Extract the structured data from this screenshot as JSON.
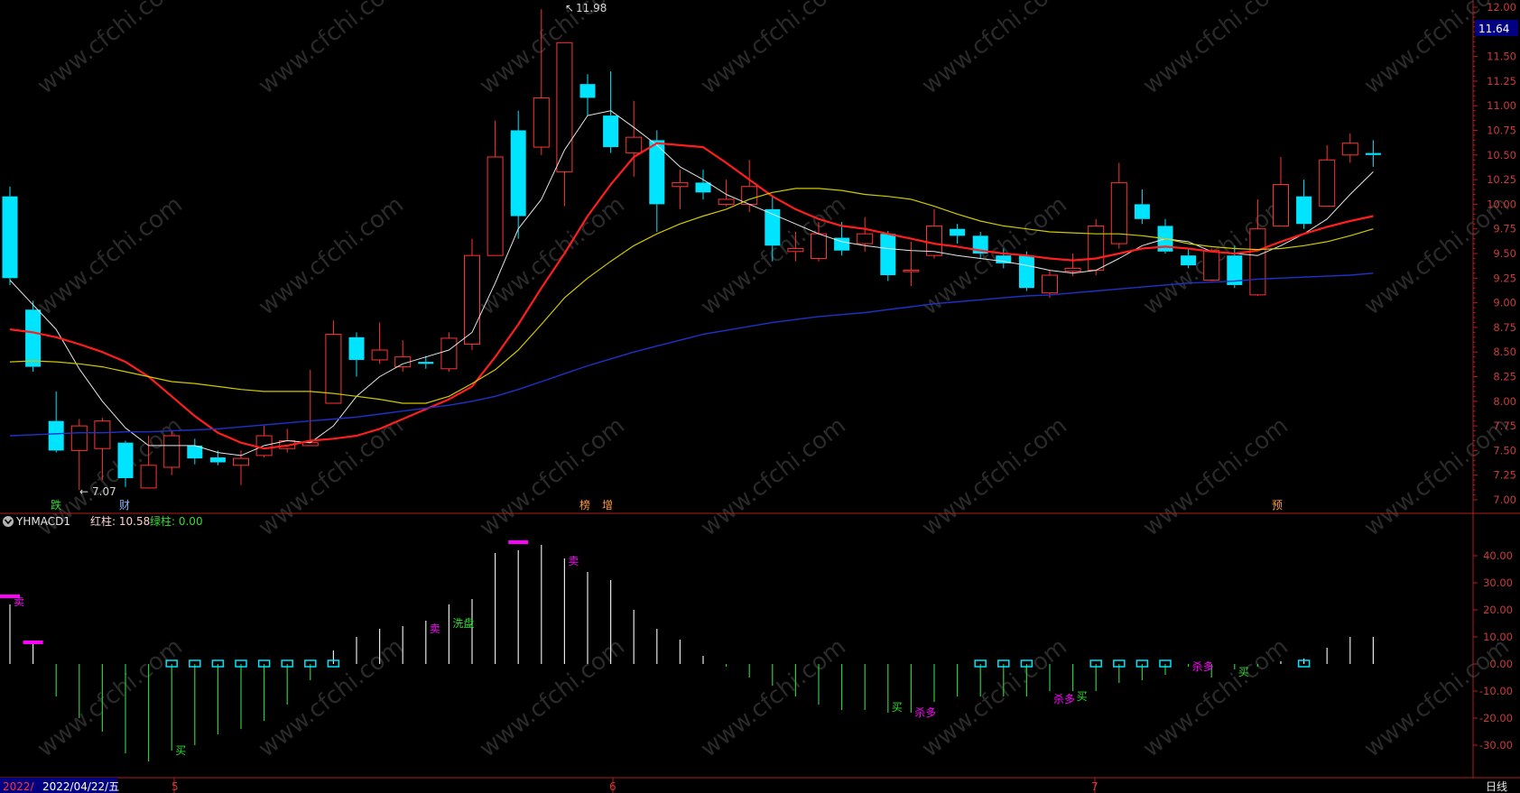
{
  "colors": {
    "bg": "#000000",
    "up": "#ff3232",
    "down": "#00e4ff",
    "axis": "#b41e1e",
    "axis_text": "#c83c3c",
    "ma5": "#e6e6e6",
    "ma10": "#ff1e1e",
    "ma20": "#d2c800",
    "ma60": "#1e32c8",
    "macd_pos": "#e6e6e6",
    "macd_neg": "#2fc83c",
    "marker_cyan": "#00e4ff",
    "magenta": "#ff00ff",
    "green_text": "#32dc32"
  },
  "price_axis": {
    "min": 7.0,
    "max": 12.0,
    "ticks": [
      "7.00",
      "7.25",
      "7.50",
      "7.75",
      "8.00",
      "8.25",
      "8.50",
      "8.75",
      "9.00",
      "9.25",
      "9.50",
      "9.75",
      "10.00",
      "10.25",
      "10.50",
      "10.75",
      "11.00",
      "11.25",
      "11.50",
      "11.75",
      "12.00"
    ],
    "current_price": "11.64"
  },
  "macd_axis": {
    "min": -42,
    "max": 52,
    "ticks": [
      "-30.00",
      "-20.00",
      "-10.00",
      "0.00",
      "10.00",
      "20.00",
      "30.00",
      "40.00"
    ]
  },
  "annotations": {
    "high_label": "11.98",
    "low_label": "7.07"
  },
  "event_markers": [
    "跌",
    "财",
    "榜",
    "增",
    "预"
  ],
  "indicator": {
    "name": "YHMACD1",
    "red_label": "红柱: 10.58",
    "green_label": "绿柱: 0.00"
  },
  "signals": [
    "卖",
    "卖",
    "卖",
    "洗盘",
    "买",
    "买",
    "杀多",
    "杀多",
    "买",
    "杀多",
    "买"
  ],
  "time_axis": {
    "labels": [
      "2022/",
      "2022/04/22/五",
      "5",
      "6",
      "7"
    ],
    "period": "日线"
  },
  "chart_data": [
    {
      "type": "candlestick",
      "title": "",
      "xlabel": "",
      "ylabel": "",
      "ylim": [
        7.0,
        12.0
      ],
      "candles": [
        [
          10.08,
          9.25,
          10.18,
          9.18
        ],
        [
          8.93,
          8.35,
          9.02,
          8.3
        ],
        [
          7.8,
          7.5,
          8.1,
          7.48
        ],
        [
          7.5,
          7.75,
          7.82,
          7.1
        ],
        [
          7.52,
          7.8,
          7.83,
          7.2
        ],
        [
          7.58,
          7.22,
          7.6,
          7.13
        ],
        [
          7.12,
          7.35,
          7.65,
          7.12
        ],
        [
          7.33,
          7.65,
          7.7,
          7.25
        ],
        [
          7.55,
          7.42,
          7.62,
          7.36
        ],
        [
          7.43,
          7.38,
          7.5,
          7.35
        ],
        [
          7.35,
          7.42,
          7.5,
          7.15
        ],
        [
          7.45,
          7.65,
          7.75,
          7.43
        ],
        [
          7.52,
          7.6,
          7.72,
          7.48
        ],
        [
          7.55,
          7.58,
          8.32,
          7.55
        ],
        [
          7.98,
          8.68,
          8.82,
          7.98
        ],
        [
          8.65,
          8.42,
          8.7,
          8.25
        ],
        [
          8.42,
          8.52,
          8.8,
          8.38
        ],
        [
          8.35,
          8.45,
          8.62,
          8.3
        ],
        [
          8.4,
          8.38,
          8.46,
          8.33
        ],
        [
          8.33,
          8.64,
          8.7,
          8.3
        ],
        [
          8.58,
          9.48,
          9.65,
          8.52
        ],
        [
          9.48,
          10.48,
          10.85,
          9.48
        ],
        [
          10.75,
          9.88,
          10.95,
          9.65
        ],
        [
          10.58,
          11.08,
          11.98,
          10.5
        ],
        [
          10.33,
          11.64,
          11.64,
          9.98
        ],
        [
          11.22,
          11.08,
          11.32,
          10.9
        ],
        [
          10.9,
          10.58,
          11.35,
          10.52
        ],
        [
          10.52,
          10.68,
          11.05,
          10.28
        ],
        [
          10.65,
          10.0,
          10.75,
          9.72
        ],
        [
          10.18,
          10.22,
          10.35,
          9.95
        ],
        [
          10.22,
          10.12,
          10.35,
          10.05
        ],
        [
          10.0,
          10.05,
          10.25,
          9.98
        ],
        [
          10.0,
          10.18,
          10.45,
          9.92
        ],
        [
          9.95,
          9.58,
          10.08,
          9.42
        ],
        [
          9.52,
          9.55,
          9.72,
          9.42
        ],
        [
          9.45,
          9.7,
          9.82,
          9.42
        ],
        [
          9.66,
          9.53,
          9.82,
          9.48
        ],
        [
          9.6,
          9.7,
          9.87,
          9.52
        ],
        [
          9.7,
          9.28,
          9.73,
          9.22
        ],
        [
          9.32,
          9.33,
          9.62,
          9.17
        ],
        [
          9.48,
          9.78,
          9.95,
          9.45
        ],
        [
          9.75,
          9.68,
          9.8,
          9.6
        ],
        [
          9.68,
          9.5,
          9.72,
          9.45
        ],
        [
          9.48,
          9.4,
          9.55,
          9.35
        ],
        [
          9.48,
          9.15,
          9.52,
          9.12
        ],
        [
          9.1,
          9.28,
          9.33,
          9.05
        ],
        [
          9.32,
          9.35,
          9.5,
          9.27
        ],
        [
          9.33,
          9.78,
          9.85,
          9.28
        ],
        [
          9.6,
          10.22,
          10.42,
          9.55
        ],
        [
          10.0,
          9.85,
          10.15,
          9.8
        ],
        [
          9.78,
          9.52,
          9.85,
          9.5
        ],
        [
          9.48,
          9.38,
          9.55,
          9.35
        ],
        [
          9.23,
          9.53,
          9.55,
          9.22
        ],
        [
          9.48,
          9.18,
          9.58,
          9.15
        ],
        [
          9.08,
          9.75,
          10.05,
          9.07
        ],
        [
          9.78,
          10.2,
          10.48,
          9.78
        ],
        [
          10.08,
          9.8,
          10.25,
          9.75
        ],
        [
          9.98,
          10.45,
          10.6,
          9.98
        ],
        [
          10.5,
          10.62,
          10.72,
          10.42
        ],
        [
          10.52,
          10.5,
          10.65,
          10.38
        ]
      ],
      "series": [
        {
          "name": "MA5",
          "values": [
            9.23,
            8.98,
            8.73,
            8.33,
            8.0,
            7.73,
            7.55,
            7.55,
            7.55,
            7.48,
            7.45,
            7.55,
            7.6,
            7.58,
            7.75,
            8.05,
            8.25,
            8.38,
            8.45,
            8.52,
            8.7,
            9.2,
            9.75,
            10.05,
            10.55,
            10.9,
            10.95,
            10.78,
            10.6,
            10.38,
            10.25,
            10.1,
            10.0,
            9.9,
            9.8,
            9.7,
            9.62,
            9.58,
            9.55,
            9.53,
            9.52,
            9.48,
            9.45,
            9.42,
            9.38,
            9.33,
            9.3,
            9.33,
            9.45,
            9.58,
            9.65,
            9.62,
            9.52,
            9.5,
            9.48,
            9.58,
            9.7,
            9.85,
            10.1,
            10.33
          ]
        },
        {
          "name": "MA10",
          "values": [
            8.73,
            8.7,
            8.65,
            8.58,
            8.5,
            8.4,
            8.25,
            8.05,
            7.85,
            7.68,
            7.58,
            7.52,
            7.55,
            7.6,
            7.62,
            7.65,
            7.72,
            7.82,
            7.92,
            8.02,
            8.15,
            8.45,
            8.78,
            9.15,
            9.5,
            9.88,
            10.2,
            10.48,
            10.62,
            10.6,
            10.58,
            10.42,
            10.25,
            10.08,
            9.95,
            9.85,
            9.78,
            9.75,
            9.7,
            9.65,
            9.6,
            9.57,
            9.53,
            9.5,
            9.48,
            9.45,
            9.43,
            9.45,
            9.5,
            9.55,
            9.57,
            9.55,
            9.52,
            9.5,
            9.53,
            9.62,
            9.7,
            9.77,
            9.83,
            9.88
          ]
        },
        {
          "name": "MA20",
          "values": [
            8.4,
            8.41,
            8.4,
            8.38,
            8.35,
            8.3,
            8.25,
            8.2,
            8.18,
            8.15,
            8.12,
            8.1,
            8.1,
            8.1,
            8.08,
            8.05,
            8.02,
            7.98,
            7.98,
            8.05,
            8.18,
            8.32,
            8.52,
            8.78,
            9.05,
            9.25,
            9.42,
            9.58,
            9.7,
            9.8,
            9.88,
            9.95,
            10.05,
            10.12,
            10.16,
            10.16,
            10.14,
            10.1,
            10.08,
            10.05,
            9.98,
            9.9,
            9.83,
            9.78,
            9.75,
            9.72,
            9.71,
            9.7,
            9.7,
            9.68,
            9.65,
            9.6,
            9.57,
            9.55,
            9.54,
            9.55,
            9.58,
            9.62,
            9.68,
            9.75
          ]
        },
        {
          "name": "MA60",
          "values": [
            7.65,
            7.66,
            7.67,
            7.68,
            7.68,
            7.69,
            7.69,
            7.7,
            7.71,
            7.72,
            7.74,
            7.76,
            7.78,
            7.8,
            7.82,
            7.84,
            7.87,
            7.9,
            7.93,
            7.96,
            8.0,
            8.05,
            8.12,
            8.2,
            8.28,
            8.36,
            8.43,
            8.5,
            8.56,
            8.62,
            8.68,
            8.72,
            8.76,
            8.8,
            8.83,
            8.86,
            8.88,
            8.9,
            8.93,
            8.96,
            8.99,
            9.01,
            9.03,
            9.05,
            9.07,
            9.08,
            9.1,
            9.12,
            9.14,
            9.16,
            9.18,
            9.2,
            9.21,
            9.22,
            9.24,
            9.25,
            9.26,
            9.27,
            9.28,
            9.3
          ]
        }
      ]
    },
    {
      "type": "bar",
      "title": "",
      "xlabel": "",
      "ylabel": "",
      "ylim": [
        -42,
        52
      ],
      "values": [
        22,
        8,
        -12,
        -20,
        -25,
        -33,
        -36,
        -32,
        -30,
        -26,
        -24,
        -21,
        -15,
        -6,
        5,
        10,
        13,
        14,
        16,
        22,
        24,
        41,
        42,
        44,
        39,
        34,
        31,
        20,
        13,
        9,
        3,
        -1,
        -5,
        -8,
        -12,
        -15,
        -17,
        -17,
        -18,
        -18,
        -14,
        -12,
        -12,
        -12,
        -12,
        -10,
        -10,
        -10,
        -7,
        -6,
        -4,
        -1,
        -5,
        -2,
        -1,
        1,
        2,
        6,
        10,
        10
      ],
      "cyan_box_zero_markers": [
        7,
        8,
        9,
        10,
        11,
        12,
        13,
        14,
        42,
        43,
        44,
        47,
        48,
        49,
        50,
        56
      ],
      "magenta_marks": [
        {
          "index": 0,
          "value": 25
        },
        {
          "index": 1,
          "value": 8
        },
        {
          "index": 22,
          "value": 45
        }
      ],
      "signal_points": [
        {
          "label": "卖",
          "index": 0,
          "value": 23
        },
        {
          "label": "卖",
          "index": 18,
          "value": 13
        },
        {
          "label": "卖",
          "index": 24,
          "value": 38
        },
        {
          "label": "洗盘",
          "index": 19,
          "value": 15
        },
        {
          "label": "买",
          "index": 7,
          "value": -32
        },
        {
          "label": "买",
          "index": 38,
          "value": -16
        },
        {
          "label": "杀多",
          "index": 39,
          "value": -18
        },
        {
          "label": "杀多",
          "index": 45,
          "value": -13
        },
        {
          "label": "买",
          "index": 46,
          "value": -12
        },
        {
          "label": "杀多",
          "index": 51,
          "value": -1
        },
        {
          "label": "买",
          "index": 53,
          "value": -3
        }
      ]
    }
  ]
}
